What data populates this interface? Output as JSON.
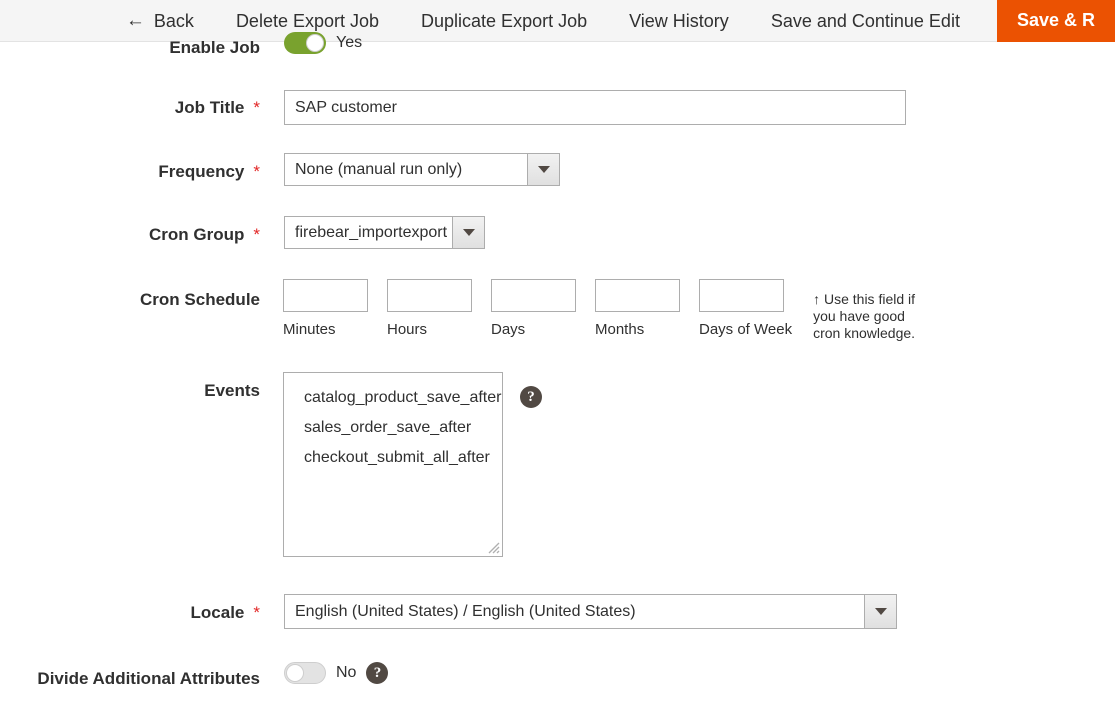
{
  "header": {
    "actions": [
      {
        "label": "Back",
        "icon": "arrow-left-icon"
      },
      {
        "label": "Delete Export Job"
      },
      {
        "label": "Duplicate Export Job"
      },
      {
        "label": "View History"
      },
      {
        "label": "Save and Continue Edit"
      }
    ],
    "primary_action": {
      "label": "Save & R",
      "color": "#eb5202"
    }
  },
  "form": {
    "enable_job": {
      "label": "Enable Job",
      "toggle_state": "Yes",
      "toggle_on": true,
      "toggle_color": "#79a22e"
    },
    "job_title": {
      "label": "Job Title",
      "required": "*",
      "value": "SAP customer"
    },
    "frequency": {
      "label": "Frequency",
      "required": "*",
      "value": "None (manual run only)"
    },
    "cron_group": {
      "label": "Cron Group",
      "required": "*",
      "value": "firebear_importexport"
    },
    "cron_schedule": {
      "label": "Cron Schedule",
      "fields": [
        {
          "sublabel": "Minutes",
          "value": ""
        },
        {
          "sublabel": "Hours",
          "value": ""
        },
        {
          "sublabel": "Days",
          "value": ""
        },
        {
          "sublabel": "Months",
          "value": ""
        },
        {
          "sublabel": "Days of Week",
          "value": ""
        }
      ],
      "hint": "↑ Use this field if you have good cron knowledge."
    },
    "events": {
      "label": "Events",
      "options": [
        "catalog_product_save_after",
        "sales_order_save_after",
        "checkout_submit_all_after"
      ],
      "help_icon": "question-mark-icon"
    },
    "locale": {
      "label": "Locale",
      "required": "*",
      "value": "English (United States) / English (United States)"
    },
    "divide_additional_attributes": {
      "label": "Divide Additional Attributes",
      "toggle_state": "No",
      "toggle_on": false,
      "help_icon": "question-mark-icon"
    }
  }
}
